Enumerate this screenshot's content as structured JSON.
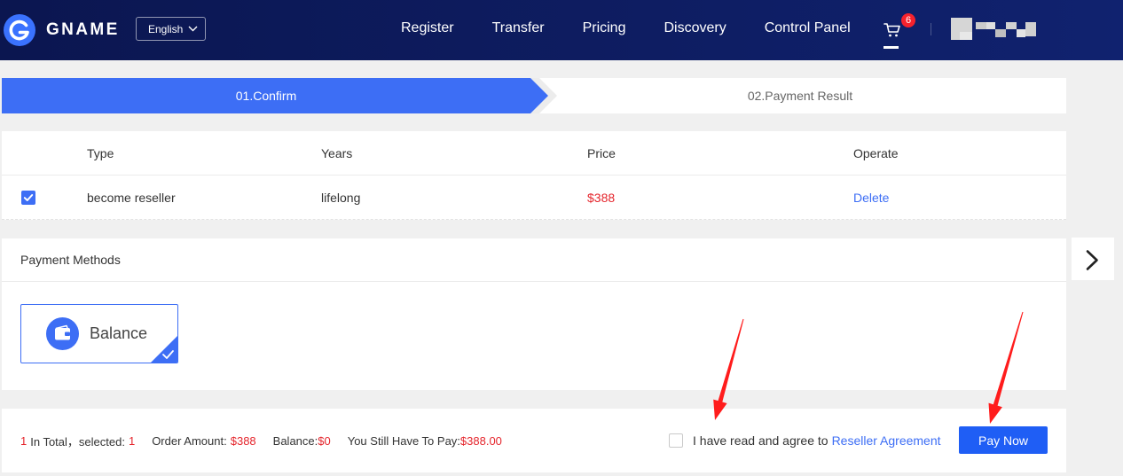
{
  "header": {
    "logo_text": "GNAME",
    "logo_icon": "logo-icon",
    "language": "English",
    "language_icon": "chevron-down-icon",
    "nav": [
      {
        "label": "Register"
      },
      {
        "label": "Transfer"
      },
      {
        "label": "Pricing"
      },
      {
        "label": "Discovery"
      },
      {
        "label": "Control Panel"
      }
    ],
    "cart_icon": "cart-icon",
    "cart_badge": "6"
  },
  "steps": [
    {
      "label": "01.Confirm",
      "active": true
    },
    {
      "label": "02.Payment Result",
      "active": false
    }
  ],
  "order_table": {
    "columns": [
      "Type",
      "Years",
      "Price",
      "Operate"
    ],
    "rows": [
      {
        "checked": true,
        "type": "become reseller",
        "years": "lifelong",
        "price": "$388",
        "operate": "Delete"
      }
    ]
  },
  "payment": {
    "title": "Payment Methods",
    "methods": [
      {
        "label": "Balance",
        "icon": "wallet-icon",
        "selected": true
      }
    ]
  },
  "side_nav": {
    "icon": "chevron-right-icon"
  },
  "summary": {
    "total_count": "1",
    "total_label": "In Total，selected:",
    "selected_count": "1",
    "order_amount_label": "Order Amount:",
    "order_amount": "$388",
    "balance_label": "Balance:",
    "balance": "$0",
    "remaining_label": "You Still Have To Pay:",
    "remaining": "$388.00",
    "agreed": false,
    "agree_text": "I have read and agree to",
    "agreement_link": "Reseller Agreement",
    "pay_button": "Pay Now"
  },
  "colors": {
    "primary": "#3d6ef5",
    "header-start": "#0b1650",
    "header-end": "#10226f",
    "price-red": "#e5262d",
    "badge-red": "#f5222d",
    "pay-button": "#1f5ef5",
    "annotation-red": "#ff1c1c",
    "page-bg": "#f0f0f0"
  }
}
